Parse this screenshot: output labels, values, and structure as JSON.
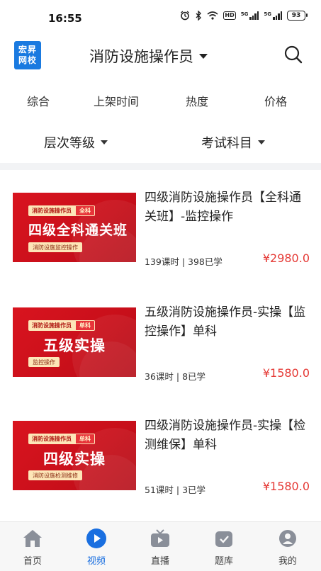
{
  "status_bar": {
    "time": "16:55",
    "battery": "93",
    "hd_label": "HD",
    "signal_label": "5G"
  },
  "header": {
    "logo_line1": "宏昇",
    "logo_line2": "网校",
    "title": "消防设施操作员"
  },
  "sort_tabs": [
    "综合",
    "上架时间",
    "热度",
    "价格"
  ],
  "filters": [
    "层次等级",
    "考试科目"
  ],
  "courses": [
    {
      "thumb_tag_main": "消防设施操作员",
      "thumb_tag_sub": "全科",
      "thumb_title": "四级全科通关班",
      "thumb_sub": "消防设施监控操作",
      "title": "四级消防设施操作员【全科通关班】-监控操作",
      "meta": "139课时 | 398已学",
      "price": "¥2980.0"
    },
    {
      "thumb_tag_main": "消防设施操作员",
      "thumb_tag_sub": "单科",
      "thumb_title": "五级实操",
      "thumb_sub": "监控操作",
      "title": "五级消防设施操作员-实操【监控操作】单科",
      "meta": "36课时 | 8已学",
      "price": "¥1580.0"
    },
    {
      "thumb_tag_main": "消防设施操作员",
      "thumb_tag_sub": "单科",
      "thumb_title": "四级实操",
      "thumb_sub": "消防设施检测维修",
      "title": "四级消防设施操作员-实操【检测维保】单科",
      "meta": "51课时 | 3已学",
      "price": "¥1580.0"
    }
  ],
  "bottom_nav": [
    {
      "label": "首页",
      "icon": "home-icon",
      "active": false
    },
    {
      "label": "视频",
      "icon": "video-play-icon",
      "active": true
    },
    {
      "label": "直播",
      "icon": "live-tv-icon",
      "active": false
    },
    {
      "label": "题库",
      "icon": "question-bank-icon",
      "active": false
    },
    {
      "label": "我的",
      "icon": "profile-icon",
      "active": false
    }
  ],
  "colors": {
    "accent": "#1a6fe0",
    "price": "#e53935",
    "thumb_red": "#d9141f"
  }
}
